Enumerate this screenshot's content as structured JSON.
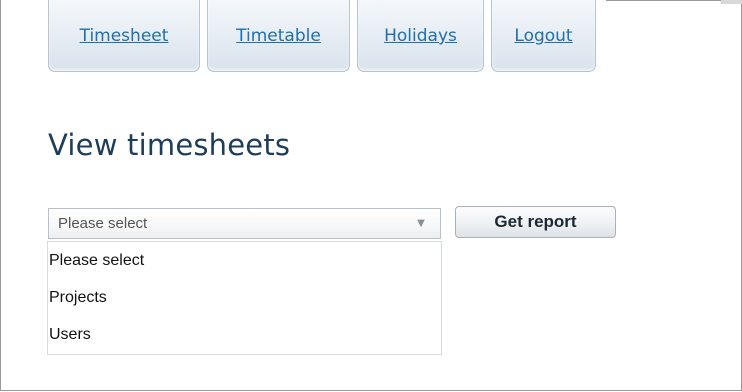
{
  "nav": {
    "tabs": [
      {
        "label": "Timesheet"
      },
      {
        "label": "Timetable"
      },
      {
        "label": "Holidays"
      },
      {
        "label": "Logout"
      }
    ]
  },
  "page": {
    "title": "View timesheets"
  },
  "report_type": {
    "value": "Please select",
    "options": [
      "Please select",
      "Projects",
      "Users"
    ]
  },
  "actions": {
    "get_report_label": "Get report"
  },
  "icons": {
    "dropdown_arrow": "chevron-down-icon"
  },
  "colors": {
    "link": "#1f6fb0",
    "heading": "#1e3d59"
  }
}
